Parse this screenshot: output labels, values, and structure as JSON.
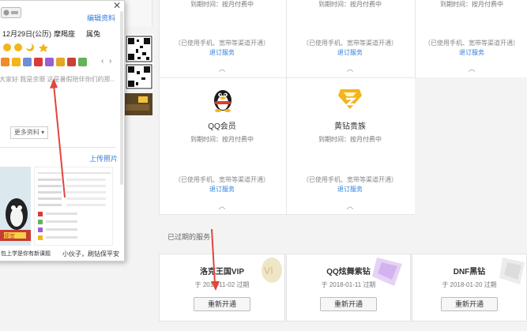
{
  "profile_panel": {
    "edit_link": "编辑资料",
    "date_line": "12月29日(公历)",
    "zodiac": "摩羯座",
    "chinese_zodiac": "属兔",
    "signature": "大家好 我是余罪 这是暑假陪伴你们的那...",
    "more_info": "更多资料 ▾",
    "upload_photo": "上传照片",
    "bottom_caption_left": "包上学是你有新课题",
    "bottom_caption_right": "小伙子，刷钻保平安",
    "promo_text": "便宜"
  },
  "services": {
    "top_row": [
      {
        "expiry": "到期时间：按月付费中",
        "note": "（已使用手机、宽带等渠道开通）",
        "link": "退订服务"
      },
      {
        "expiry": "到期时间：按月付费中",
        "note": "（已使用手机、宽带等渠道开通）",
        "link": "退订服务"
      },
      {
        "expiry": "到期时间：按月付费中",
        "note": "（已使用手机、宽带等渠道开通）",
        "link": "退订服务"
      }
    ],
    "middle_row": [
      {
        "name": "QQ会员",
        "expiry": "到期时间：按月付费中",
        "note": "（已使用手机、宽带等渠道开通）",
        "link": "退订服务"
      },
      {
        "name": "黄钻贵族",
        "expiry": "到期时间：按月付费中",
        "note": "（已使用手机、宽带等渠道开通）",
        "link": "退订服务"
      }
    ]
  },
  "expired": {
    "heading": "已过期的服务",
    "items": [
      {
        "name": "洛克王国VIP",
        "date": "于 2017-11-02 过期",
        "button": "重新开通"
      },
      {
        "name": "QQ炫舞紫钻",
        "date": "于 2018-01-11 过期",
        "button": "重新开通"
      },
      {
        "name": "DNF黑钻",
        "date": "于 2018-01-20 过期",
        "button": "重新开通"
      }
    ]
  },
  "colors": {
    "link": "#2d7ee0",
    "annotation_arrow": "#e0463e",
    "penguin_red": "#e23a2a",
    "gold": "#f3b51b"
  }
}
